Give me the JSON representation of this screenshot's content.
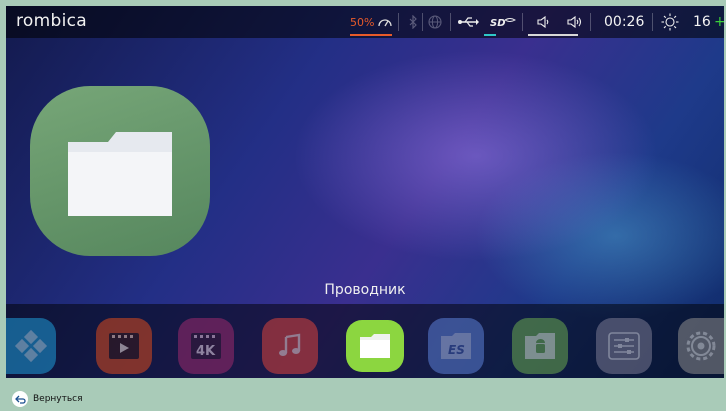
{
  "brand": {
    "logo_text": "rombica"
  },
  "status_bar": {
    "cpu_load": "50%",
    "time": "00:26",
    "temperature": "16",
    "temperature_plus": "+",
    "icons": [
      "speedometer-icon",
      "bluetooth-icon",
      "globe-icon",
      "usb-icon",
      "sd-card-icon",
      "volume-down-icon",
      "volume-up-icon",
      "brightness-icon"
    ]
  },
  "focused_app": {
    "label": "Проводник",
    "icon": "folder-icon"
  },
  "dock": {
    "apps": [
      {
        "name": "kodi-app-icon",
        "color": "#1e9bd7"
      },
      {
        "name": "video-player-app-icon",
        "color": "#d94a1c"
      },
      {
        "name": "4k-player-app-icon",
        "color": "#9b2a6c"
      },
      {
        "name": "music-app-icon",
        "color": "#d9433c"
      },
      {
        "name": "file-explorer-app-icon",
        "color": "#8cd640",
        "selected": true
      },
      {
        "name": "es-file-explorer-app-icon",
        "color": "#5b7fd6"
      },
      {
        "name": "android-folder-app-icon",
        "color": "#6aa84f"
      },
      {
        "name": "settings-list-app-icon",
        "color": "#8a8aa8"
      },
      {
        "name": "gear-settings-app-icon",
        "color": "#9a9a9a"
      }
    ]
  },
  "footer": {
    "back_label": "Вернуться"
  }
}
